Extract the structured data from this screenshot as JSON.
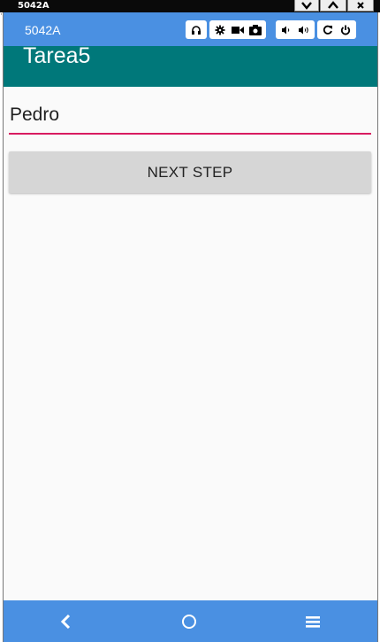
{
  "window": {
    "title": "5042A"
  },
  "emulator": {
    "device_name": "5042A",
    "toolbar_icons": [
      "headphones-icon",
      "gear-icon",
      "video-camera-icon",
      "camera-icon",
      "volume-down-icon",
      "volume-up-icon",
      "rotate-icon",
      "power-icon"
    ]
  },
  "app": {
    "title": "Tarea5",
    "name_field": {
      "value": "Pedro"
    },
    "next_button": {
      "label": "NEXT STEP"
    }
  },
  "nav": {
    "icons": [
      "back-icon",
      "home-icon",
      "menu-icon"
    ]
  },
  "colors": {
    "emulator_bar": "#4a90e2",
    "app_bar": "#00787a",
    "field_underline": "#d81b60",
    "button_bg": "#d6d6d6"
  }
}
